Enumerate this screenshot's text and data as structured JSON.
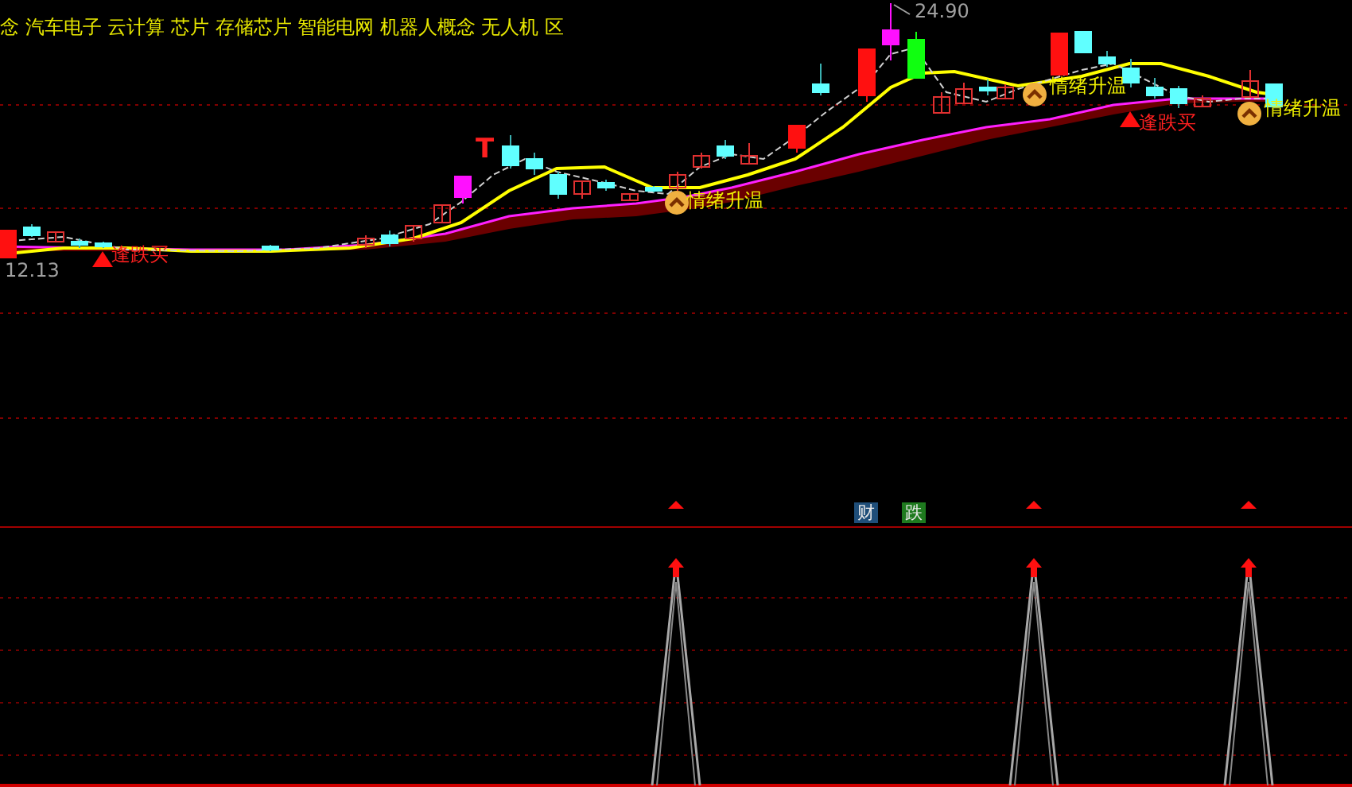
{
  "concept_bar": {
    "text": "念 汽车电子 云计算 芯片 存储芯片 智能电网 机器人概念 无人机 区"
  },
  "price_high": "24.90",
  "price_low": "12.13",
  "t_marker": "T",
  "signals": [
    {
      "kind": "buy",
      "label": "逢跌买"
    },
    {
      "kind": "mood",
      "label": "情绪升温"
    },
    {
      "kind": "mood",
      "label": "情绪升温"
    },
    {
      "kind": "buy",
      "label": "逢跌买"
    },
    {
      "kind": "mood",
      "label": "情绪升温"
    }
  ],
  "badges": [
    {
      "label": "财",
      "color": "#1f4e79"
    },
    {
      "label": "跌",
      "color": "#1e7a1e"
    }
  ]
}
